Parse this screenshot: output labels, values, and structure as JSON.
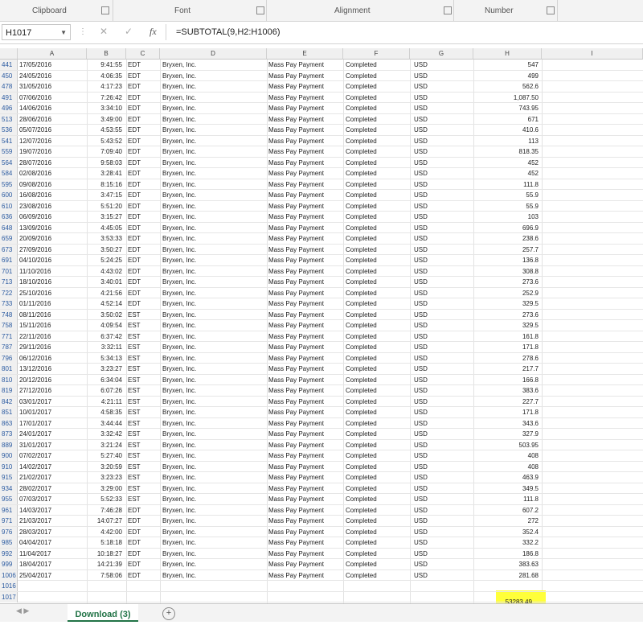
{
  "ribbon": {
    "groups": [
      {
        "label": "Clipboard"
      },
      {
        "label": "Font"
      },
      {
        "label": "Alignment"
      },
      {
        "label": "Number"
      }
    ]
  },
  "formula_bar": {
    "name_box": "H1017",
    "fx": "fx",
    "cancel": "✕",
    "enter": "✓",
    "formula": "=SUBTOTAL(9,H2:H1006)"
  },
  "columns": [
    "A",
    "B",
    "C",
    "D",
    "E",
    "F",
    "G",
    "H",
    "I"
  ],
  "rows": [
    {
      "n": "441",
      "a": "17/05/2016",
      "b": "9:41:55",
      "c": "EDT",
      "d": "Bryxen, Inc.",
      "e": "Mass Pay Payment",
      "f": "Completed",
      "g": "USD",
      "h": "547"
    },
    {
      "n": "450",
      "a": "24/05/2016",
      "b": "4:06:35",
      "c": "EDT",
      "d": "Bryxen, Inc.",
      "e": "Mass Pay Payment",
      "f": "Completed",
      "g": "USD",
      "h": "499"
    },
    {
      "n": "478",
      "a": "31/05/2016",
      "b": "4:17:23",
      "c": "EDT",
      "d": "Bryxen, Inc.",
      "e": "Mass Pay Payment",
      "f": "Completed",
      "g": "USD",
      "h": "562.6"
    },
    {
      "n": "491",
      "a": "07/06/2016",
      "b": "7:26:42",
      "c": "EDT",
      "d": "Bryxen, Inc.",
      "e": "Mass Pay Payment",
      "f": "Completed",
      "g": "USD",
      "h": "1,087.50"
    },
    {
      "n": "496",
      "a": "14/06/2016",
      "b": "3:34:10",
      "c": "EDT",
      "d": "Bryxen, Inc.",
      "e": "Mass Pay Payment",
      "f": "Completed",
      "g": "USD",
      "h": "743.95"
    },
    {
      "n": "513",
      "a": "28/06/2016",
      "b": "3:49:00",
      "c": "EDT",
      "d": "Bryxen, Inc.",
      "e": "Mass Pay Payment",
      "f": "Completed",
      "g": "USD",
      "h": "671"
    },
    {
      "n": "536",
      "a": "05/07/2016",
      "b": "4:53:55",
      "c": "EDT",
      "d": "Bryxen, Inc.",
      "e": "Mass Pay Payment",
      "f": "Completed",
      "g": "USD",
      "h": "410.6"
    },
    {
      "n": "541",
      "a": "12/07/2016",
      "b": "5:43:52",
      "c": "EDT",
      "d": "Bryxen, Inc.",
      "e": "Mass Pay Payment",
      "f": "Completed",
      "g": "USD",
      "h": "113"
    },
    {
      "n": "559",
      "a": "19/07/2016",
      "b": "7:09:40",
      "c": "EDT",
      "d": "Bryxen, Inc.",
      "e": "Mass Pay Payment",
      "f": "Completed",
      "g": "USD",
      "h": "818.35"
    },
    {
      "n": "564",
      "a": "28/07/2016",
      "b": "9:58:03",
      "c": "EDT",
      "d": "Bryxen, Inc.",
      "e": "Mass Pay Payment",
      "f": "Completed",
      "g": "USD",
      "h": "452"
    },
    {
      "n": "584",
      "a": "02/08/2016",
      "b": "3:28:41",
      "c": "EDT",
      "d": "Bryxen, Inc.",
      "e": "Mass Pay Payment",
      "f": "Completed",
      "g": "USD",
      "h": "452"
    },
    {
      "n": "595",
      "a": "09/08/2016",
      "b": "8:15:16",
      "c": "EDT",
      "d": "Bryxen, Inc.",
      "e": "Mass Pay Payment",
      "f": "Completed",
      "g": "USD",
      "h": "111.8"
    },
    {
      "n": "600",
      "a": "16/08/2016",
      "b": "3:47:15",
      "c": "EDT",
      "d": "Bryxen, Inc.",
      "e": "Mass Pay Payment",
      "f": "Completed",
      "g": "USD",
      "h": "55.9"
    },
    {
      "n": "610",
      "a": "23/08/2016",
      "b": "5:51:20",
      "c": "EDT",
      "d": "Bryxen, Inc.",
      "e": "Mass Pay Payment",
      "f": "Completed",
      "g": "USD",
      "h": "55.9"
    },
    {
      "n": "636",
      "a": "06/09/2016",
      "b": "3:15:27",
      "c": "EDT",
      "d": "Bryxen, Inc.",
      "e": "Mass Pay Payment",
      "f": "Completed",
      "g": "USD",
      "h": "103"
    },
    {
      "n": "648",
      "a": "13/09/2016",
      "b": "4:45:05",
      "c": "EDT",
      "d": "Bryxen, Inc.",
      "e": "Mass Pay Payment",
      "f": "Completed",
      "g": "USD",
      "h": "696.9"
    },
    {
      "n": "659",
      "a": "20/09/2016",
      "b": "3:53:33",
      "c": "EDT",
      "d": "Bryxen, Inc.",
      "e": "Mass Pay Payment",
      "f": "Completed",
      "g": "USD",
      "h": "238.6"
    },
    {
      "n": "673",
      "a": "27/09/2016",
      "b": "3:50:27",
      "c": "EDT",
      "d": "Bryxen, Inc.",
      "e": "Mass Pay Payment",
      "f": "Completed",
      "g": "USD",
      "h": "257.7"
    },
    {
      "n": "691",
      "a": "04/10/2016",
      "b": "5:24:25",
      "c": "EDT",
      "d": "Bryxen, Inc.",
      "e": "Mass Pay Payment",
      "f": "Completed",
      "g": "USD",
      "h": "136.8"
    },
    {
      "n": "701",
      "a": "11/10/2016",
      "b": "4:43:02",
      "c": "EDT",
      "d": "Bryxen, Inc.",
      "e": "Mass Pay Payment",
      "f": "Completed",
      "g": "USD",
      "h": "308.8"
    },
    {
      "n": "713",
      "a": "18/10/2016",
      "b": "3:40:01",
      "c": "EDT",
      "d": "Bryxen, Inc.",
      "e": "Mass Pay Payment",
      "f": "Completed",
      "g": "USD",
      "h": "273.6"
    },
    {
      "n": "722",
      "a": "25/10/2016",
      "b": "4:21:56",
      "c": "EDT",
      "d": "Bryxen, Inc.",
      "e": "Mass Pay Payment",
      "f": "Completed",
      "g": "USD",
      "h": "252.9"
    },
    {
      "n": "733",
      "a": "01/11/2016",
      "b": "4:52:14",
      "c": "EDT",
      "d": "Bryxen, Inc.",
      "e": "Mass Pay Payment",
      "f": "Completed",
      "g": "USD",
      "h": "329.5"
    },
    {
      "n": "748",
      "a": "08/11/2016",
      "b": "3:50:02",
      "c": "EST",
      "d": "Bryxen, Inc.",
      "e": "Mass Pay Payment",
      "f": "Completed",
      "g": "USD",
      "h": "273.6"
    },
    {
      "n": "758",
      "a": "15/11/2016",
      "b": "4:09:54",
      "c": "EST",
      "d": "Bryxen, Inc.",
      "e": "Mass Pay Payment",
      "f": "Completed",
      "g": "USD",
      "h": "329.5"
    },
    {
      "n": "771",
      "a": "22/11/2016",
      "b": "6:37:42",
      "c": "EST",
      "d": "Bryxen, Inc.",
      "e": "Mass Pay Payment",
      "f": "Completed",
      "g": "USD",
      "h": "161.8"
    },
    {
      "n": "787",
      "a": "29/11/2016",
      "b": "3:32:11",
      "c": "EST",
      "d": "Bryxen, Inc.",
      "e": "Mass Pay Payment",
      "f": "Completed",
      "g": "USD",
      "h": "171.8"
    },
    {
      "n": "796",
      "a": "06/12/2016",
      "b": "5:34:13",
      "c": "EST",
      "d": "Bryxen, Inc.",
      "e": "Mass Pay Payment",
      "f": "Completed",
      "g": "USD",
      "h": "278.6"
    },
    {
      "n": "801",
      "a": "13/12/2016",
      "b": "3:23:27",
      "c": "EST",
      "d": "Bryxen, Inc.",
      "e": "Mass Pay Payment",
      "f": "Completed",
      "g": "USD",
      "h": "217.7"
    },
    {
      "n": "810",
      "a": "20/12/2016",
      "b": "6:34:04",
      "c": "EST",
      "d": "Bryxen, Inc.",
      "e": "Mass Pay Payment",
      "f": "Completed",
      "g": "USD",
      "h": "166.8"
    },
    {
      "n": "819",
      "a": "27/12/2016",
      "b": "6:07:26",
      "c": "EST",
      "d": "Bryxen, Inc.",
      "e": "Mass Pay Payment",
      "f": "Completed",
      "g": "USD",
      "h": "383.6"
    },
    {
      "n": "842",
      "a": "03/01/2017",
      "b": "4:21:11",
      "c": "EST",
      "d": "Bryxen, Inc.",
      "e": "Mass Pay Payment",
      "f": "Completed",
      "g": "USD",
      "h": "227.7"
    },
    {
      "n": "851",
      "a": "10/01/2017",
      "b": "4:58:35",
      "c": "EST",
      "d": "Bryxen, Inc.",
      "e": "Mass Pay Payment",
      "f": "Completed",
      "g": "USD",
      "h": "171.8"
    },
    {
      "n": "863",
      "a": "17/01/2017",
      "b": "3:44:44",
      "c": "EST",
      "d": "Bryxen, Inc.",
      "e": "Mass Pay Payment",
      "f": "Completed",
      "g": "USD",
      "h": "343.6"
    },
    {
      "n": "873",
      "a": "24/01/2017",
      "b": "3:32:42",
      "c": "EST",
      "d": "Bryxen, Inc.",
      "e": "Mass Pay Payment",
      "f": "Completed",
      "g": "USD",
      "h": "327.9"
    },
    {
      "n": "889",
      "a": "31/01/2017",
      "b": "3:21:24",
      "c": "EST",
      "d": "Bryxen, Inc.",
      "e": "Mass Pay Payment",
      "f": "Completed",
      "g": "USD",
      "h": "503.95"
    },
    {
      "n": "900",
      "a": "07/02/2017",
      "b": "5:27:40",
      "c": "EST",
      "d": "Bryxen, Inc.",
      "e": "Mass Pay Payment",
      "f": "Completed",
      "g": "USD",
      "h": "408"
    },
    {
      "n": "910",
      "a": "14/02/2017",
      "b": "3:20:59",
      "c": "EST",
      "d": "Bryxen, Inc.",
      "e": "Mass Pay Payment",
      "f": "Completed",
      "g": "USD",
      "h": "408"
    },
    {
      "n": "915",
      "a": "21/02/2017",
      "b": "3:23:23",
      "c": "EST",
      "d": "Bryxen, Inc.",
      "e": "Mass Pay Payment",
      "f": "Completed",
      "g": "USD",
      "h": "463.9"
    },
    {
      "n": "934",
      "a": "28/02/2017",
      "b": "3:29:00",
      "c": "EST",
      "d": "Bryxen, Inc.",
      "e": "Mass Pay Payment",
      "f": "Completed",
      "g": "USD",
      "h": "349.5"
    },
    {
      "n": "955",
      "a": "07/03/2017",
      "b": "5:52:33",
      "c": "EST",
      "d": "Bryxen, Inc.",
      "e": "Mass Pay Payment",
      "f": "Completed",
      "g": "USD",
      "h": "111.8"
    },
    {
      "n": "961",
      "a": "14/03/2017",
      "b": "7:46:28",
      "c": "EDT",
      "d": "Bryxen, Inc.",
      "e": "Mass Pay Payment",
      "f": "Completed",
      "g": "USD",
      "h": "607.2"
    },
    {
      "n": "971",
      "a": "21/03/2017",
      "b": "14:07:27",
      "c": "EDT",
      "d": "Bryxen, Inc.",
      "e": "Mass Pay Payment",
      "f": "Completed",
      "g": "USD",
      "h": "272"
    },
    {
      "n": "976",
      "a": "28/03/2017",
      "b": "4:42:00",
      "c": "EDT",
      "d": "Bryxen, Inc.",
      "e": "Mass Pay Payment",
      "f": "Completed",
      "g": "USD",
      "h": "352.4"
    },
    {
      "n": "985",
      "a": "04/04/2017",
      "b": "5:18:18",
      "c": "EDT",
      "d": "Bryxen, Inc.",
      "e": "Mass Pay Payment",
      "f": "Completed",
      "g": "USD",
      "h": "332.2"
    },
    {
      "n": "992",
      "a": "11/04/2017",
      "b": "10:18:27",
      "c": "EDT",
      "d": "Bryxen, Inc.",
      "e": "Mass Pay Payment",
      "f": "Completed",
      "g": "USD",
      "h": "186.8"
    },
    {
      "n": "999",
      "a": "18/04/2017",
      "b": "14:21:39",
      "c": "EDT",
      "d": "Bryxen, Inc.",
      "e": "Mass Pay Payment",
      "f": "Completed",
      "g": "USD",
      "h": "383.63"
    },
    {
      "n": "1006",
      "a": "25/04/2017",
      "b": "7:58:06",
      "c": "EDT",
      "d": "Bryxen, Inc.",
      "e": "Mass Pay Payment",
      "f": "Completed",
      "g": "USD",
      "h": "281.68"
    },
    {
      "n": "1016",
      "a": "",
      "b": "",
      "c": "",
      "d": "",
      "e": "",
      "f": "",
      "g": "",
      "h": ""
    },
    {
      "n": "1017",
      "a": "",
      "b": "",
      "c": "",
      "d": "",
      "e": "",
      "f": "",
      "g": "",
      "h": "53283.49"
    }
  ],
  "highlight_color": "#ffff3a",
  "tabs": {
    "active": "Download (3)",
    "add_icon": "plus-circle-icon"
  }
}
